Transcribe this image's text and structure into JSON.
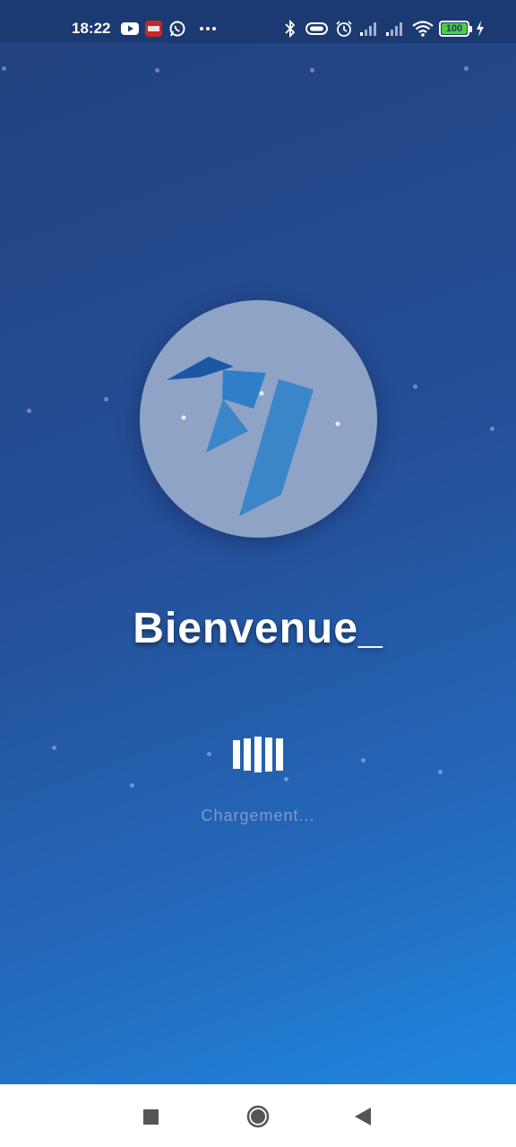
{
  "status_bar": {
    "time": "18:22",
    "battery_level": "100",
    "left_icons": [
      "youtube-icon",
      "news-app-icon",
      "whatsapp-icon",
      "more-notifications-icon"
    ],
    "right_icons": [
      "bluetooth-icon",
      "battery-saver-icon",
      "alarm-icon",
      "signal-icon",
      "signal-icon",
      "wifi-icon",
      "battery-icon",
      "charging-icon"
    ]
  },
  "splash": {
    "title": "Bienvenue_",
    "loading_text": "Chargement..."
  },
  "nav_bar": {
    "buttons": [
      "recents-button",
      "home-button",
      "back-button"
    ]
  },
  "colors": {
    "status_bar_bg": "#1c3a72",
    "gradient_top": "#22417f",
    "gradient_bottom": "#1f86df",
    "logo_circle": "#8ea3c6",
    "logo_dark_blue": "#1c57a4",
    "logo_light_blue": "#3b86c9",
    "battery_green": "#4cd137"
  }
}
